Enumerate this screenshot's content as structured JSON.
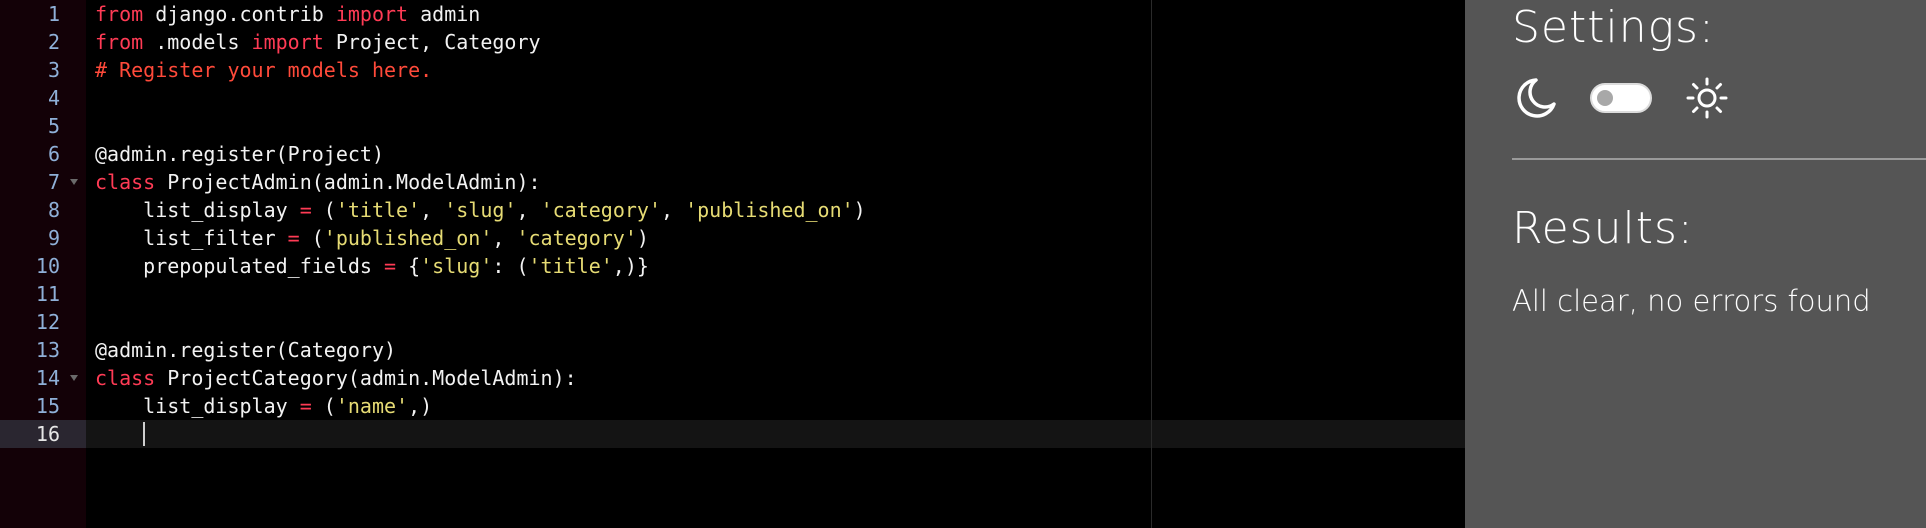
{
  "editor": {
    "lines": [
      {
        "num": "1",
        "tokens": [
          [
            "kw",
            "from"
          ],
          [
            "pl",
            " django.contrib "
          ],
          [
            "kw",
            "import"
          ],
          [
            "pl",
            " admin"
          ]
        ]
      },
      {
        "num": "2",
        "tokens": [
          [
            "kw",
            "from"
          ],
          [
            "pl",
            " .models "
          ],
          [
            "kw",
            "import"
          ],
          [
            "pl",
            " Project, Category"
          ]
        ]
      },
      {
        "num": "3",
        "tokens": [
          [
            "cm",
            "# Register your models here."
          ]
        ]
      },
      {
        "num": "4",
        "tokens": []
      },
      {
        "num": "5",
        "tokens": []
      },
      {
        "num": "6",
        "tokens": [
          [
            "pl",
            "@admin.register(Project)"
          ]
        ]
      },
      {
        "num": "7",
        "fold": true,
        "tokens": [
          [
            "kw",
            "class"
          ],
          [
            "pl",
            " ProjectAdmin(admin.ModelAdmin):"
          ]
        ]
      },
      {
        "num": "8",
        "tokens": [
          [
            "pl",
            "    list_display "
          ],
          [
            "kw",
            "="
          ],
          [
            "pl",
            " ("
          ],
          [
            "str",
            "'title'"
          ],
          [
            "pl",
            ", "
          ],
          [
            "str",
            "'slug'"
          ],
          [
            "pl",
            ", "
          ],
          [
            "str",
            "'category'"
          ],
          [
            "pl",
            ", "
          ],
          [
            "str",
            "'published_on'"
          ],
          [
            "pl",
            ")"
          ]
        ]
      },
      {
        "num": "9",
        "tokens": [
          [
            "pl",
            "    list_filter "
          ],
          [
            "kw",
            "="
          ],
          [
            "pl",
            " ("
          ],
          [
            "str",
            "'published_on'"
          ],
          [
            "pl",
            ", "
          ],
          [
            "str",
            "'category'"
          ],
          [
            "pl",
            ")"
          ]
        ]
      },
      {
        "num": "10",
        "tokens": [
          [
            "pl",
            "    prepopulated_fields "
          ],
          [
            "kw",
            "="
          ],
          [
            "pl",
            " {"
          ],
          [
            "str",
            "'slug'"
          ],
          [
            "pl",
            ": ("
          ],
          [
            "str",
            "'title'"
          ],
          [
            "pl",
            ",)}"
          ]
        ]
      },
      {
        "num": "11",
        "tokens": []
      },
      {
        "num": "12",
        "tokens": []
      },
      {
        "num": "13",
        "tokens": [
          [
            "pl",
            "@admin.register(Category)"
          ]
        ]
      },
      {
        "num": "14",
        "fold": true,
        "tokens": [
          [
            "kw",
            "class"
          ],
          [
            "pl",
            " ProjectCategory(admin.ModelAdmin):"
          ]
        ]
      },
      {
        "num": "15",
        "tokens": [
          [
            "pl",
            "    list_display "
          ],
          [
            "kw",
            "="
          ],
          [
            "pl",
            " ("
          ],
          [
            "str",
            "'name'"
          ],
          [
            "pl",
            ",)"
          ]
        ]
      },
      {
        "num": "16",
        "active": true,
        "cursor": true,
        "tokens": [
          [
            "pl",
            "    "
          ]
        ]
      }
    ]
  },
  "panel": {
    "settings_title": "Settings:",
    "theme": {
      "dark_icon": "moon-icon",
      "light_icon": "sun-icon",
      "toggle_state": "off"
    },
    "results_title": "Results:",
    "results_text": "All clear, no errors found"
  },
  "colors": {
    "editor_bg": "#000000",
    "gutter_bg": "#130107",
    "panel_bg": "#555555",
    "keyword": "#ff3b55",
    "string": "#e6db74",
    "comment": "#ff4a3a"
  }
}
